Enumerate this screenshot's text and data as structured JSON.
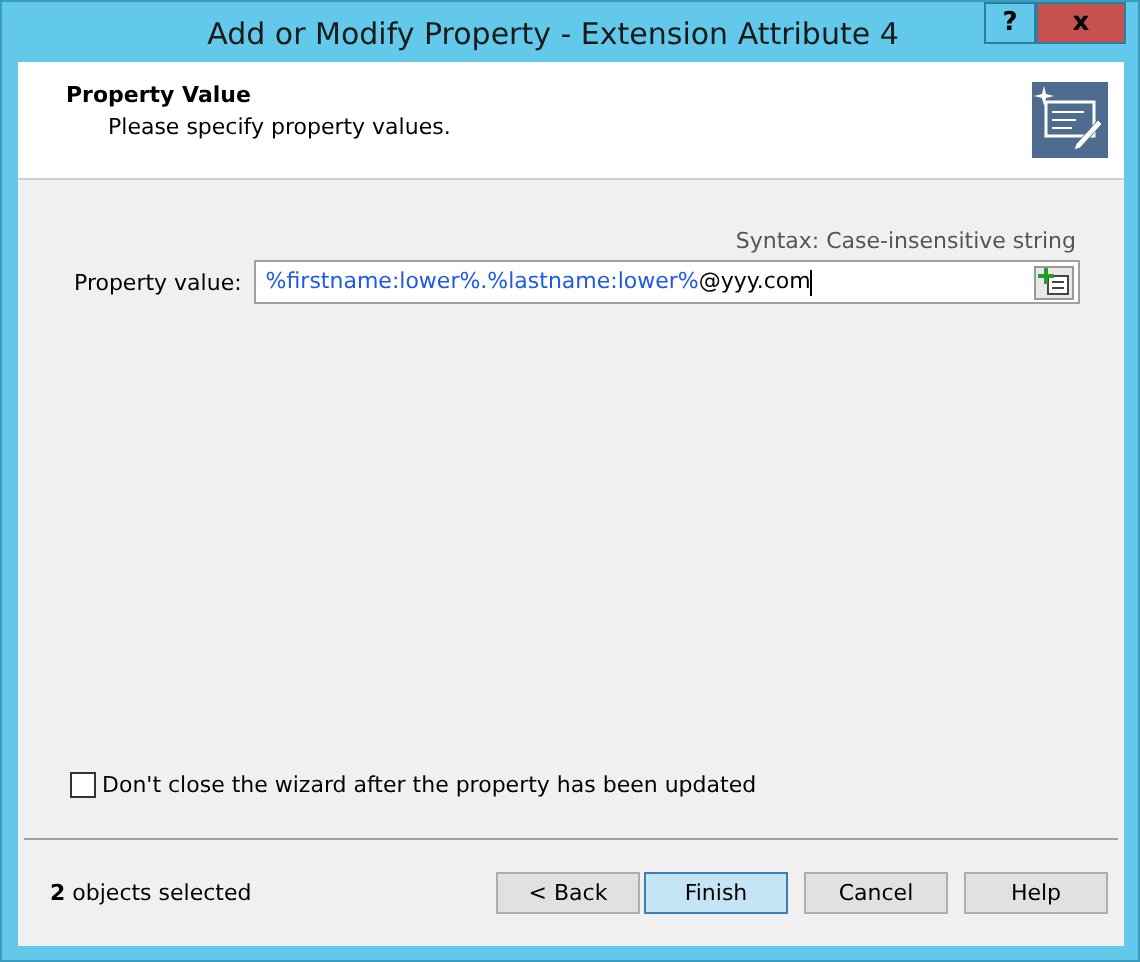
{
  "window": {
    "title": "Add or Modify Property - Extension Attribute 4",
    "controls": [
      {
        "kind": "help",
        "label": "?"
      },
      {
        "kind": "close",
        "label": "x"
      }
    ]
  },
  "header": {
    "title": "Property Value",
    "subtitle": "Please specify property values."
  },
  "syntax": "Syntax: Case-insensitive string",
  "property": {
    "label": "Property value:",
    "value": [
      {
        "kind": "variable",
        "text": "%firstname:lower%.%lastname:lower%"
      },
      {
        "kind": "text",
        "text": "@yyy.com"
      }
    ]
  },
  "keep_open": {
    "label": "Don't close the wizard after the property has been updated",
    "checked": false
  },
  "status": "**2** objects selected",
  "buttons": [
    {
      "label": "< Back",
      "default": false
    },
    {
      "label": "Finish",
      "default": true
    },
    {
      "label": "Cancel",
      "default": false
    },
    {
      "label": "Help",
      "default": false
    }
  ]
}
